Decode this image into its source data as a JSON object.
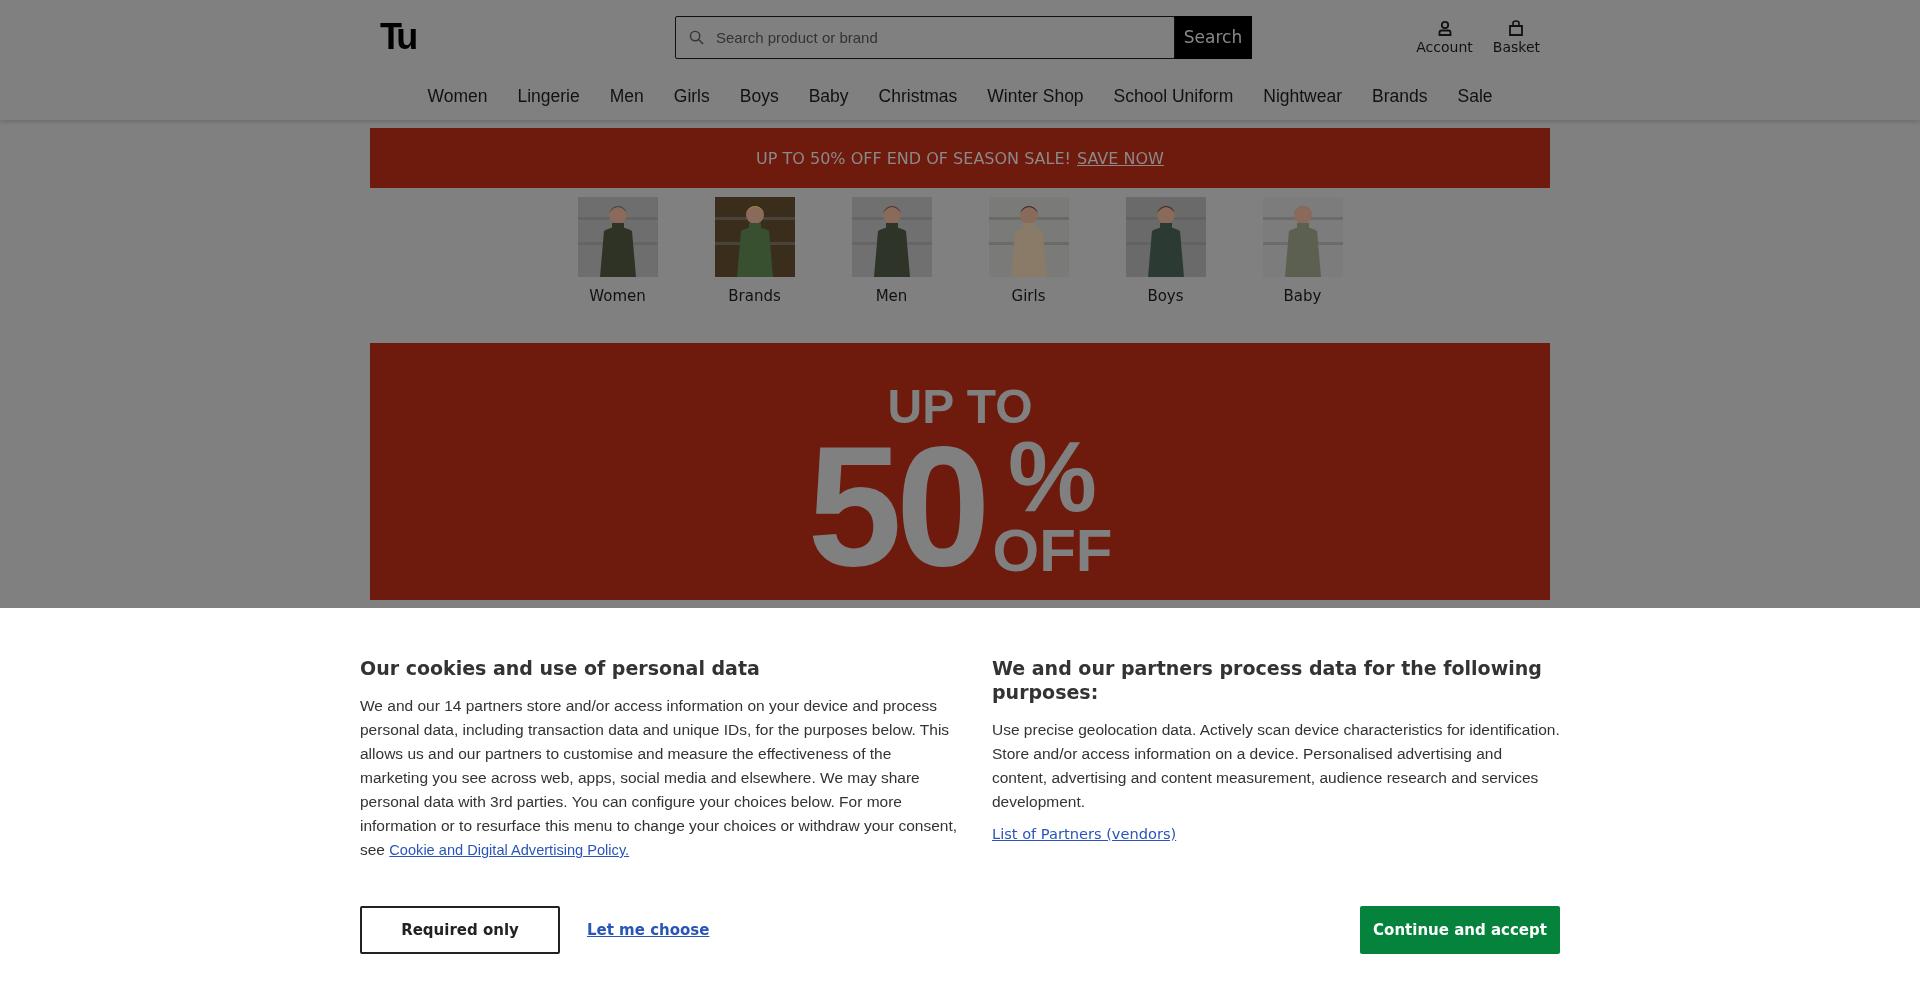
{
  "header": {
    "logo": "Tu",
    "search": {
      "placeholder": "Search product or brand",
      "button": "Search"
    },
    "actions": [
      {
        "label": "Account",
        "kind": "account"
      },
      {
        "label": "Basket",
        "kind": "basket"
      }
    ]
  },
  "nav": [
    "Women",
    "Lingerie",
    "Men",
    "Girls",
    "Boys",
    "Baby",
    "Christmas",
    "Winter Shop",
    "School Uniform",
    "Nightwear",
    "Brands",
    "Sale"
  ],
  "promo_strip": {
    "text": "UP TO 50% OFF END OF SEASON SALE!",
    "link": "SAVE NOW"
  },
  "categories": [
    {
      "label": "Women",
      "kind": "picture"
    },
    {
      "label": "Brands",
      "kind": "picture"
    },
    {
      "label": "Men",
      "kind": "picture"
    },
    {
      "label": "Girls",
      "kind": "picture"
    },
    {
      "label": "Boys",
      "kind": "picture"
    },
    {
      "label": "Baby",
      "kind": "picture"
    }
  ],
  "hero": {
    "line_1": "UP TO",
    "number": "50",
    "percent": "%",
    "off": "OFF"
  },
  "cookie_banner": {
    "left": {
      "title": "Our cookies and use of personal data",
      "body": "We and our 14 partners store and/or access information on your device and process personal data, including transaction data and unique IDs, for the purposes below. This allows us and our partners to customise and measure the effectiveness of the marketing you see across web, apps, social media and elsewhere. We may share personal data with 3rd parties. You can configure your choices below. For more information or to resurface this menu to change your choices or withdraw your consent, see",
      "link": "Cookie and Digital Advertising Policy."
    },
    "right": {
      "title": "We and our partners process data for the following purposes:",
      "body": "Use precise geolocation data. Actively scan device characteristics for identification. Store and/or access information on a device. Personalised advertising and content, advertising and content measurement, audience research and services development.",
      "link": "List of Partners (vendors)"
    },
    "buttons": [
      {
        "label": "Required only",
        "kind": "outline"
      },
      {
        "label": "Let me choose",
        "kind": "link"
      },
      {
        "label": "Continue and accept",
        "kind": "primary"
      }
    ]
  }
}
